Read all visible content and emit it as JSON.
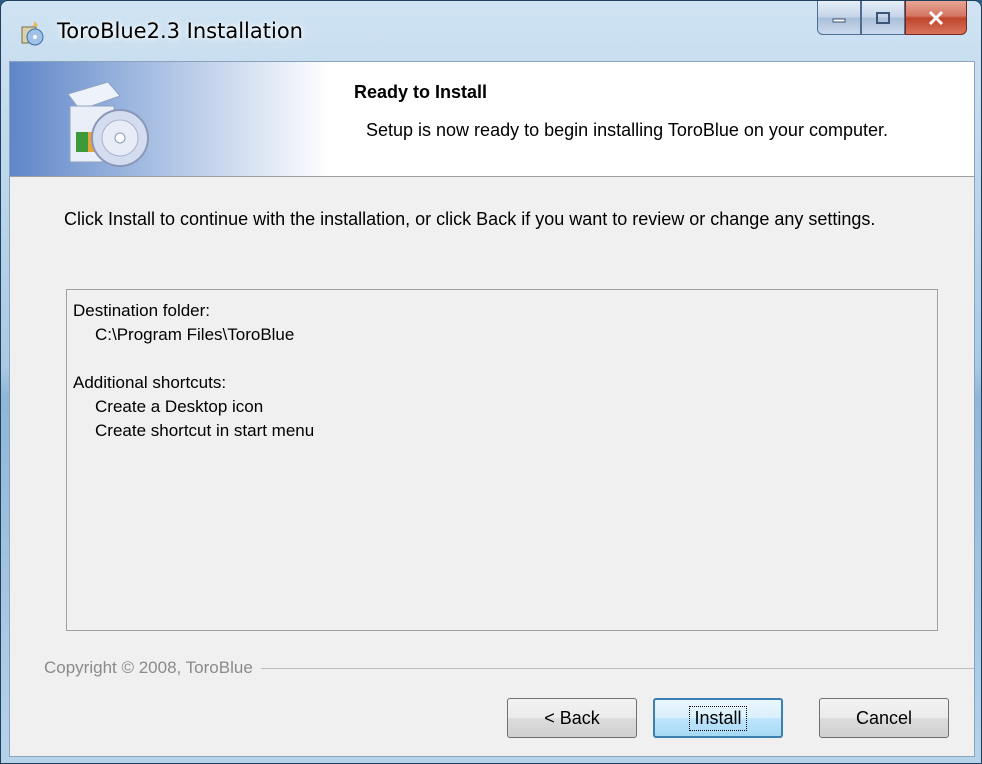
{
  "window": {
    "title": "ToroBlue2.3 Installation",
    "caption_buttons": [
      "minimize-icon",
      "maximize-icon",
      "close-icon"
    ]
  },
  "header": {
    "title": "Ready to Install",
    "subtitle": "Setup is now ready to begin installing ToroBlue on your computer.",
    "icon": "setup-cd-icon"
  },
  "body": {
    "intro": "Click Install to continue with the installation, or click Back if you want to review or change any settings."
  },
  "summary": {
    "destination_heading": "Destination folder:",
    "destination_path": "C:\\Program Files\\ToroBlue",
    "shortcuts_heading": "Additional shortcuts:",
    "shortcuts": [
      "Create a Desktop icon",
      "Create shortcut in start menu"
    ]
  },
  "footer": {
    "copyright": "Copyright © 2008, ToroBlue"
  },
  "buttons": {
    "back": "< Back",
    "install": "Install",
    "cancel": "Cancel"
  },
  "colors": {
    "accent": "#3c7fb1",
    "close_button": "#c0452d",
    "header_gradient": "#5f86c8"
  }
}
